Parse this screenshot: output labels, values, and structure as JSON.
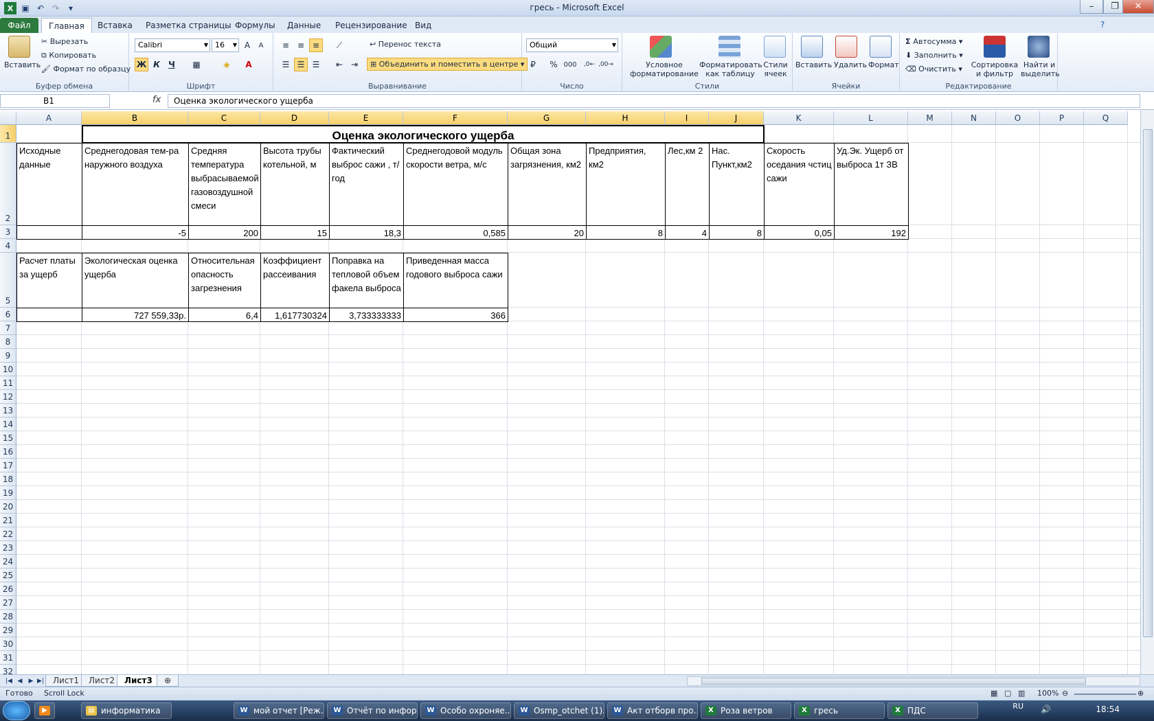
{
  "window": {
    "title": "гресь  -  Microsoft Excel"
  },
  "ribbon_tabs": [
    "Файл",
    "Главная",
    "Вставка",
    "Разметка страницы",
    "Формулы",
    "Данные",
    "Рецензирование",
    "Вид"
  ],
  "clipboard": {
    "paste": "Вставить",
    "cut": "Вырезать",
    "copy": "Копировать",
    "format": "Формат по образцу",
    "label": "Буфер обмена"
  },
  "font": {
    "name": "Calibri",
    "size": "16",
    "bold": "Ж",
    "italic": "К",
    "underline": "Ч",
    "label": "Шрифт"
  },
  "alignment": {
    "wrap": "Перенос текста",
    "merge": "Объединить и поместить в центре",
    "label": "Выравнивание"
  },
  "number": {
    "format": "Общий",
    "label": "Число"
  },
  "styles": {
    "conditional": "Условное форматирование",
    "as_table": "Форматировать как таблицу",
    "cell_styles": "Стили ячеек",
    "label": "Стили"
  },
  "cells": {
    "insert": "Вставить",
    "delete": "Удалить",
    "format": "Формат",
    "label": "Ячейки"
  },
  "editing": {
    "autosum": "Автосумма",
    "fill": "Заполнить",
    "clear": "Очистить",
    "sort": "Сортировка и фильтр",
    "find": "Найти и выделить",
    "label": "Редактирование"
  },
  "formula_bar": {
    "name_box": "B1",
    "fx": "fx",
    "content": "Оценка экологического ущерба"
  },
  "columns": [
    "A",
    "B",
    "C",
    "D",
    "E",
    "F",
    "G",
    "H",
    "I",
    "J",
    "K",
    "L",
    "M",
    "N",
    "O",
    "P",
    "Q"
  ],
  "rows": [
    "1",
    "2",
    "3",
    "4",
    "5",
    "6",
    "7",
    "8",
    "9",
    "10",
    "11",
    "12",
    "13",
    "14",
    "15",
    "16",
    "17",
    "18",
    "19",
    "20",
    "21",
    "22",
    "23",
    "24",
    "25",
    "26",
    "27",
    "28",
    "29",
    "30",
    "31",
    "32"
  ],
  "sheet": {
    "title": "Оценка экологического ущерба",
    "row2": [
      "Исходные данные",
      "Среднегодовая тем-ра наружного воздуха",
      "Средняя температура выбрасываемой газовоздушной смеси",
      "Высота трубы котельной, м",
      "Фактический выброс сажи , т/год",
      "Среднегодовой модуль скорости ветра, м/с",
      "Общая зона загрязнения, км2",
      "Предприятия, км2",
      "Лес,км 2",
      "Нас. Пункт,км2",
      "Скорость оседания чстиц сажи",
      "Уд.Эк. Ущерб от выброса 1т ЗВ"
    ],
    "row3": [
      "",
      "-5",
      "200",
      "15",
      "18,3",
      "0,585",
      "20",
      "8",
      "4",
      "8",
      "0,05",
      "192"
    ],
    "row5": [
      "Расчет платы за ущерб",
      "Экологическая оценка ущерба",
      "Относительная опасность загрезнения",
      "Коэффициент рассеивания",
      "Поправка на тепловой объем факела выброса",
      "Приведенная масса годового выброса сажи"
    ],
    "row6": [
      "",
      "727 559,33р.",
      "6,4",
      "1,617730324",
      "3,733333333",
      "366"
    ]
  },
  "sheet_tabs": [
    "Лист1",
    "Лист2",
    "Лист3"
  ],
  "status": {
    "ready": "Готово",
    "scroll_lock": "Scroll Lock",
    "zoom": "100%"
  },
  "taskbar": {
    "items": [
      "информатика",
      "мой отчет [Реж...",
      "Отчёт по инфор...",
      "Особо охроняе...",
      "Osmp_otchet (1)...",
      "Акт отборв про...",
      "Роза ветров",
      "гресь",
      "ПДС"
    ],
    "lang": "RU",
    "time": "18:54"
  }
}
